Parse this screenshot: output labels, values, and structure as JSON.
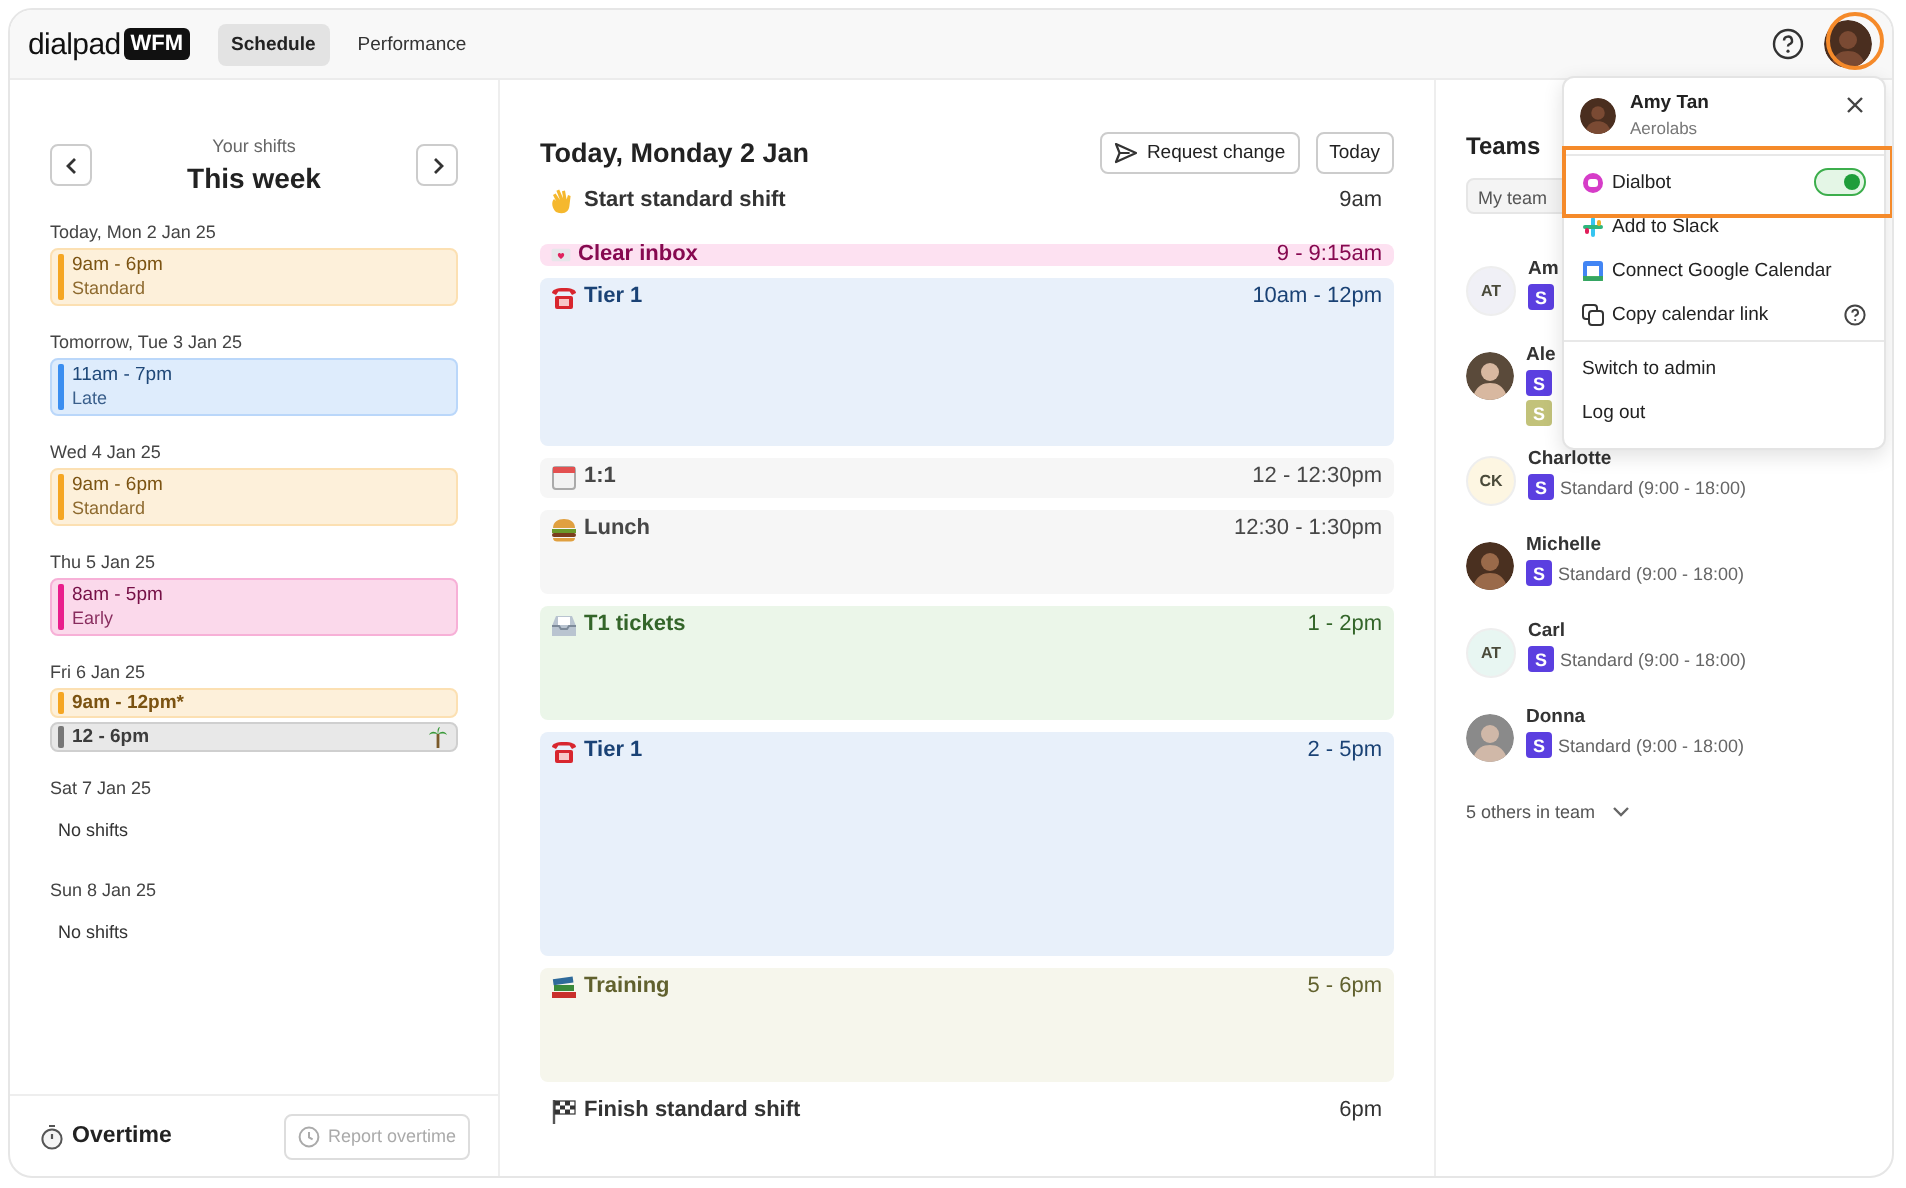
{
  "app": {
    "logo": "dialpad",
    "logo_badge": "WFM"
  },
  "tabs": [
    {
      "label": "Schedule",
      "selected": true
    },
    {
      "label": "Performance",
      "selected": false
    }
  ],
  "week": {
    "caption": "Your shifts",
    "title": "This week",
    "days": [
      {
        "label": "Today, Mon 2 Jan 25",
        "shifts": [
          {
            "time": "9am - 6pm",
            "label": "Standard",
            "color": "#f5a623"
          }
        ]
      },
      {
        "label": "Tomorrow, Tue 3 Jan 25",
        "shifts": [
          {
            "time": "11am - 7pm",
            "label": "Late",
            "color": "#3b8ef0"
          }
        ]
      },
      {
        "label": "Wed 4 Jan 25",
        "shifts": [
          {
            "time": "9am - 6pm",
            "label": "Standard",
            "color": "#f5a623"
          }
        ]
      },
      {
        "label": "Thu 5 Jan 25",
        "shifts": [
          {
            "time": "8am - 5pm",
            "label": "Early",
            "color": "#e91e8c"
          }
        ]
      },
      {
        "label": "Fri 6 Jan 25",
        "shifts": [
          {
            "time": "9am - 12pm*",
            "color": "#f5a623"
          },
          {
            "time": "12 - 6pm",
            "color": "#777777",
            "holiday": true
          }
        ]
      },
      {
        "label": "Sat 7 Jan 25",
        "empty": "No shifts"
      },
      {
        "label": "Sun 8 Jan 25",
        "empty": "No shifts"
      }
    ]
  },
  "overtime": {
    "title": "Overtime",
    "button": "Report overtime",
    "button_disabled": true
  },
  "day": {
    "title": "Today, Monday 2 Jan",
    "buttons": [
      "Request change",
      "Today"
    ],
    "events": [
      {
        "kind": "marker",
        "title": "Start standard shift",
        "time": "9am"
      },
      {
        "kind": "block",
        "title": "Clear inbox",
        "time": "9 - 9:15am",
        "color": "#fde1f1"
      },
      {
        "kind": "block",
        "title": "Tier 1",
        "time": "10am - 12pm",
        "color": "#e8f0fa"
      },
      {
        "kind": "block",
        "title": "1:1",
        "time": "12 - 12:30pm",
        "color": "#f6f6f6"
      },
      {
        "kind": "block",
        "title": "Lunch",
        "time": "12:30 - 1:30pm",
        "color": "#f6f6f6"
      },
      {
        "kind": "block",
        "title": "T1 tickets",
        "time": "1 - 2pm",
        "color": "#ebf6e9"
      },
      {
        "kind": "block",
        "title": "Tier 1",
        "time": "2 - 5pm",
        "color": "#e8f0fa"
      },
      {
        "kind": "block",
        "title": "Training",
        "time": "5 - 6pm",
        "color": "#f6f6ec"
      },
      {
        "kind": "marker",
        "title": "Finish standard shift",
        "time": "6pm"
      }
    ]
  },
  "teams": {
    "title": "Teams",
    "filter": "My team",
    "members": [
      {
        "name": "Am",
        "kind": "initials",
        "initials": "AT",
        "color": "#f0f0f6",
        "shifts": [
          {
            "badge": "S",
            "color": "#5b3fe0"
          }
        ]
      },
      {
        "name": "Ale",
        "kind": "photo",
        "shifts": [
          {
            "badge": "S",
            "color": "#5b3fe0"
          },
          {
            "badge": "S",
            "color": "#c2c27a"
          }
        ]
      },
      {
        "name": "Charlotte",
        "kind": "initials",
        "initials": "CK",
        "color": "#fdf6e2",
        "shifts": [
          {
            "badge": "S",
            "color": "#5b3fe0",
            "label": "Standard (9:00 - 18:00)"
          }
        ]
      },
      {
        "name": "Michelle",
        "kind": "photo",
        "shifts": [
          {
            "badge": "S",
            "color": "#5b3fe0",
            "label": "Standard (9:00 - 18:00)"
          }
        ]
      },
      {
        "name": "Carl",
        "kind": "initials",
        "initials": "AT",
        "color": "#e8f6f2",
        "shifts": [
          {
            "badge": "S",
            "color": "#5b3fe0",
            "label": "Standard (9:00 - 18:00)"
          }
        ]
      },
      {
        "name": "Donna",
        "kind": "photo",
        "shifts": [
          {
            "badge": "S",
            "color": "#5b3fe0",
            "label": "Standard (9:00 - 18:00)"
          }
        ]
      }
    ],
    "more": "5 others in team"
  },
  "menu": {
    "open": true,
    "name": "Amy Tan",
    "org": "Aerolabs",
    "items": [
      {
        "kind": "toggle",
        "label": "Dialbot",
        "on": true,
        "highlighted": true
      },
      {
        "kind": "link",
        "label": "Add to Slack"
      },
      {
        "kind": "link",
        "label": "Connect Google Calendar"
      },
      {
        "kind": "help",
        "label": "Copy calendar link"
      },
      {
        "kind": "plain",
        "label": "Switch to admin",
        "divider": true
      },
      {
        "kind": "plain",
        "label": "Log out"
      }
    ]
  }
}
